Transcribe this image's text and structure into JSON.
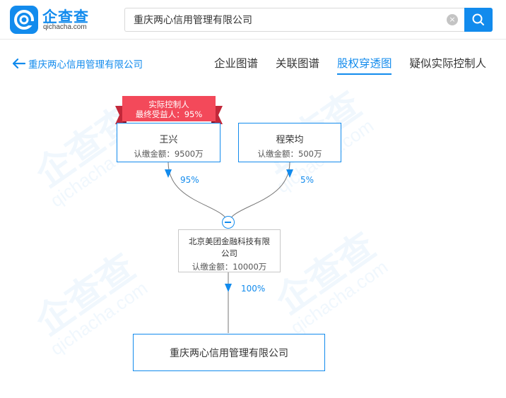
{
  "brand": {
    "name": "企查查",
    "domain": "qichacha.com"
  },
  "search": {
    "value": "重庆两心信用管理有限公司",
    "clear_icon": "×"
  },
  "nav": {
    "back_label": "重庆两心信用管理有限公司",
    "tabs": [
      {
        "label": "企业图谱",
        "active": false
      },
      {
        "label": "关联图谱",
        "active": false
      },
      {
        "label": "股权穿透图",
        "active": true
      },
      {
        "label": "疑似实际控制人",
        "active": false
      }
    ]
  },
  "graph": {
    "ribbon": {
      "line1": "实际控制人",
      "line2": "最终受益人：95%"
    },
    "shareholders": [
      {
        "name": "王兴",
        "amount": "认缴金额：9500万",
        "percent": "95%"
      },
      {
        "name": "程荣均",
        "amount": "认缴金额：500万",
        "percent": "5%"
      }
    ],
    "middle": {
      "name_line1": "北京美团金融科技有限",
      "name_line2": "公司",
      "amount": "认缴金额：10000万",
      "percent": "100%"
    },
    "target": {
      "name": "重庆两心信用管理有限公司"
    }
  },
  "colors": {
    "accent": "#128bed",
    "ribbon": "#f3495a",
    "ribbon_dark": "#c2283a",
    "line": "#777777"
  }
}
